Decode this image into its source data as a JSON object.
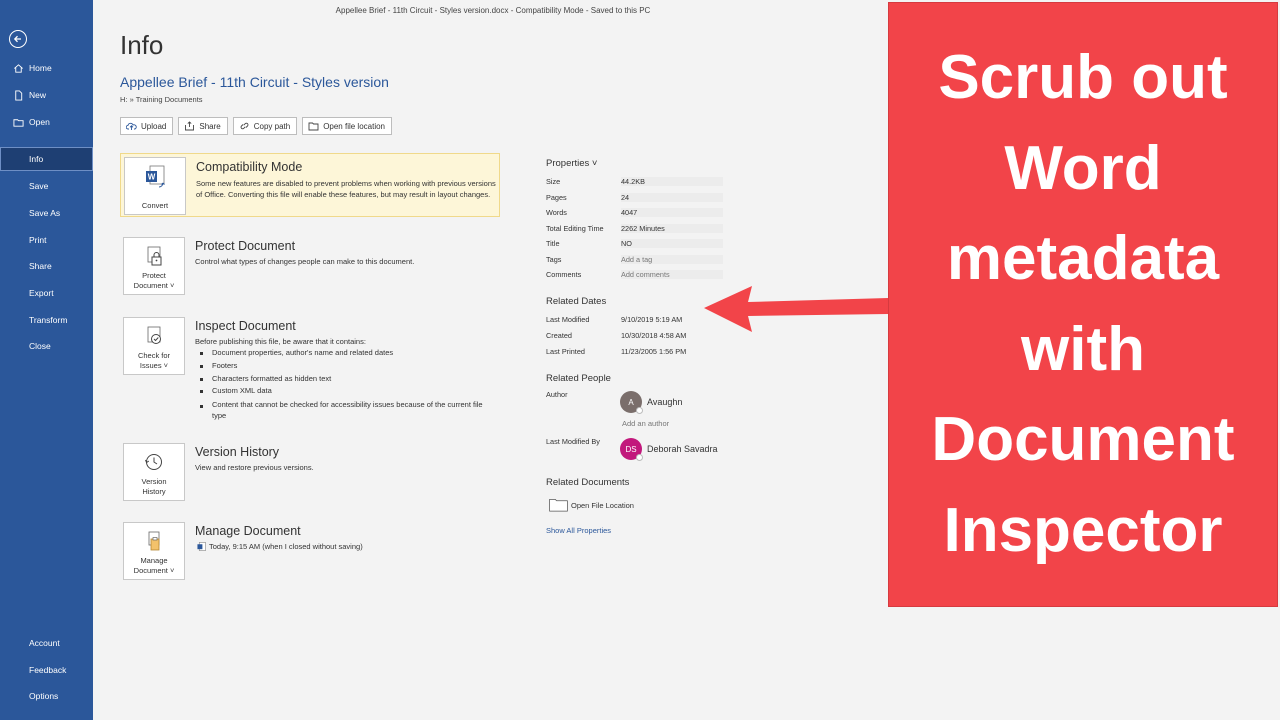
{
  "window": {
    "title": "Appellee Brief - 11th Circuit - Styles version.docx  -  Compatibility Mode  -  Saved to this PC"
  },
  "sidebar": {
    "top_items": [
      {
        "label": "Home",
        "icon": "home-icon"
      },
      {
        "label": "New",
        "icon": "new-document-icon"
      },
      {
        "label": "Open",
        "icon": "folder-open-icon"
      }
    ],
    "items": [
      {
        "label": "Info",
        "active": true
      },
      {
        "label": "Save"
      },
      {
        "label": "Save As"
      },
      {
        "label": "Print"
      },
      {
        "label": "Share"
      },
      {
        "label": "Export"
      },
      {
        "label": "Transform"
      },
      {
        "label": "Close"
      }
    ],
    "bottom_items": [
      {
        "label": "Account"
      },
      {
        "label": "Feedback"
      },
      {
        "label": "Options"
      }
    ]
  },
  "info": {
    "page_title": "Info",
    "doc_title": "Appellee Brief - 11th Circuit - Styles version",
    "doc_path": "H: » Training Documents",
    "actions": [
      {
        "label": "Upload",
        "icon": "upload-icon"
      },
      {
        "label": "Share",
        "icon": "share-icon"
      },
      {
        "label": "Copy path",
        "icon": "copy-path-icon"
      },
      {
        "label": "Open file location",
        "icon": "folder-icon"
      }
    ]
  },
  "compatibility": {
    "tile": "Convert",
    "heading": "Compatibility Mode",
    "text": "Some new features are disabled to prevent problems when working with previous versions of Office. Converting this file will enable these features, but may result in layout changes."
  },
  "protect": {
    "tile_line1": "Protect",
    "tile_line2": "Document ˅",
    "heading": "Protect Document",
    "text": "Control what types of changes people can make to this document."
  },
  "inspect": {
    "tile_line1": "Check for",
    "tile_line2": "Issues ˅",
    "heading": "Inspect Document",
    "text": "Before publishing this file, be aware that it contains:",
    "items": [
      "Document properties, author's name and related dates",
      "Footers",
      "Characters formatted as hidden text",
      "Custom XML data",
      "Content that cannot be checked for accessibility issues because of the current file type"
    ]
  },
  "version": {
    "tile_line1": "Version",
    "tile_line2": "History",
    "heading": "Version History",
    "text": "View and restore previous versions."
  },
  "manage": {
    "tile_line1": "Manage",
    "tile_line2": "Document ˅",
    "heading": "Manage Document",
    "text": "Today, 9:15 AM (when I closed without saving)"
  },
  "properties": {
    "heading": "Properties ˅",
    "rows": [
      {
        "key": "Size",
        "value": "44.2KB"
      },
      {
        "key": "Pages",
        "value": "24"
      },
      {
        "key": "Words",
        "value": "4047"
      },
      {
        "key": "Total Editing Time",
        "value": "2262 Minutes"
      },
      {
        "key": "Title",
        "value": "NO"
      },
      {
        "key": "Tags",
        "value": "Add a tag"
      },
      {
        "key": "Comments",
        "value": "Add comments"
      }
    ]
  },
  "related_dates": {
    "heading": "Related Dates",
    "rows": [
      {
        "key": "Last Modified",
        "value": "9/10/2019 5:19 AM"
      },
      {
        "key": "Created",
        "value": "10/30/2018 4:58 AM"
      },
      {
        "key": "Last Printed",
        "value": "11/23/2005 1:56 PM"
      }
    ]
  },
  "related_people": {
    "heading": "Related People",
    "author_label": "Author",
    "author_initial": "A",
    "author_name": "Avaughn",
    "add_author": "Add an author",
    "modified_by_label": "Last Modified By",
    "modified_by_initials": "DS",
    "modified_by_name": "Deborah Savadra"
  },
  "related_documents": {
    "heading": "Related Documents",
    "open_location": "Open File Location",
    "show_all": "Show All Properties"
  },
  "overlay": {
    "lines": [
      "Scrub out",
      "Word",
      "metadata",
      "with",
      "Document",
      "Inspector"
    ],
    "color": "#f24449"
  },
  "colors": {
    "sidebar": "#2b579a",
    "accent": "#2b579a"
  }
}
